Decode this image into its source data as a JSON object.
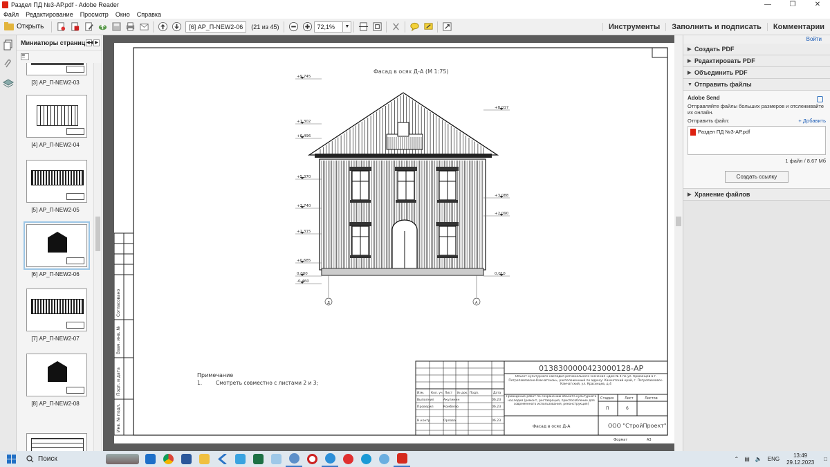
{
  "window": {
    "title": "Раздел ПД №3-АР.pdf - Adobe Reader"
  },
  "menu": [
    "Файл",
    "Редактирование",
    "Просмотр",
    "Окно",
    "Справка"
  ],
  "toolbar": {
    "open_label": "Открыть",
    "page_name": "[6] АР_П-NEW2-06",
    "page_count": "(21 из 45)",
    "zoom": "72,1%"
  },
  "toolbar_right": {
    "tools": "Инструменты",
    "fill_sign": "Заполнить и подписать",
    "comments": "Комментарии"
  },
  "thumbnails": {
    "header": "Миниатюры страниц",
    "items": [
      {
        "label": "[3] АР_П-NEW2-03",
        "kind": "partial"
      },
      {
        "label": "[4] АР_П-NEW2-04",
        "kind": "section"
      },
      {
        "label": "[5] АР_П-NEW2-05",
        "kind": "elevation"
      },
      {
        "label": "[6] АР_П-NEW2-06",
        "kind": "facade",
        "selected": true
      },
      {
        "label": "[7] АР_П-NEW2-07",
        "kind": "elevation"
      },
      {
        "label": "[8] АР_П-NEW2-08",
        "kind": "facade"
      },
      {
        "label": "",
        "kind": "plan"
      }
    ]
  },
  "drawing": {
    "title": "Фасад в осях Д-А (М 1:75)",
    "levels_left": [
      "+9,745",
      "+7,302",
      "+6,496",
      "+5,370",
      "+3,740",
      "+2,315",
      "+0,685",
      "0,000",
      "-0,460"
    ],
    "levels_right": [
      "+8,017",
      "+3,088",
      "+2,090",
      "0,010"
    ],
    "axes": [
      "Д",
      "А"
    ],
    "left_labels": [
      "Согласовано",
      "Взам. инв. №",
      "Подп. и дата",
      "Инв. № подл."
    ],
    "note_title": "Примечание",
    "note_number": "1.",
    "note_text": "Смотреть совместно с листами 2 и 3;",
    "stamp": {
      "code": "0138300000423000128-АР",
      "object": "Объект культурного наследия регионального значения «Дом № 4 по ул. Красинцев в г. Петропавловске-Камчатском», расположенный по адресу: Камчатский край, г. Петропавловск-Камчатский, ул. Красинцев, д.4",
      "work": "Проведение работ по сохранению объекта культурного наследия (ремонт, реставрация, приспособление для современного использования, реконструкция)",
      "sheet_title": "Фасад в осях Д-А",
      "company": "ООО \"СтройПроект\"",
      "col_headers": [
        "Изм.",
        "Кол. уч.",
        "Лист",
        "№ док.",
        "Подп.",
        "Дата"
      ],
      "rows": [
        {
          "role": "Выполнил",
          "name": "Акулинин",
          "date": "06.23"
        },
        {
          "role": "Проверил",
          "name": "Комбелю",
          "date": "06.23"
        },
        {
          "role": "Н.контр",
          "name": "Орлова",
          "date": "06.23"
        }
      ],
      "stage_headers": [
        "Стадия",
        "Лист",
        "Листов"
      ],
      "stage_values": [
        "П",
        "6",
        ""
      ],
      "format_label": "Формат",
      "format_value": "А3"
    }
  },
  "right_panel": {
    "login": "Войти",
    "sections": [
      "Создать PDF",
      "Редактировать PDF",
      "Объединить PDF",
      "Отправить файлы"
    ],
    "send": {
      "name": "Adobe Send",
      "desc": "Отправляйте файлы больших размеров и отслеживайте их онлайн.",
      "file_label": "Отправить файл:",
      "add": "+ Добавить",
      "file": "Раздел ПД №3-АР.pdf",
      "count": "1 файл / 8.67 Мб",
      "button": "Создать ссылку"
    },
    "storage": "Хранение файлов"
  },
  "taskbar": {
    "search": "Поиск",
    "lang": "ENG",
    "time": "13:49",
    "date": "29.12.2023"
  }
}
